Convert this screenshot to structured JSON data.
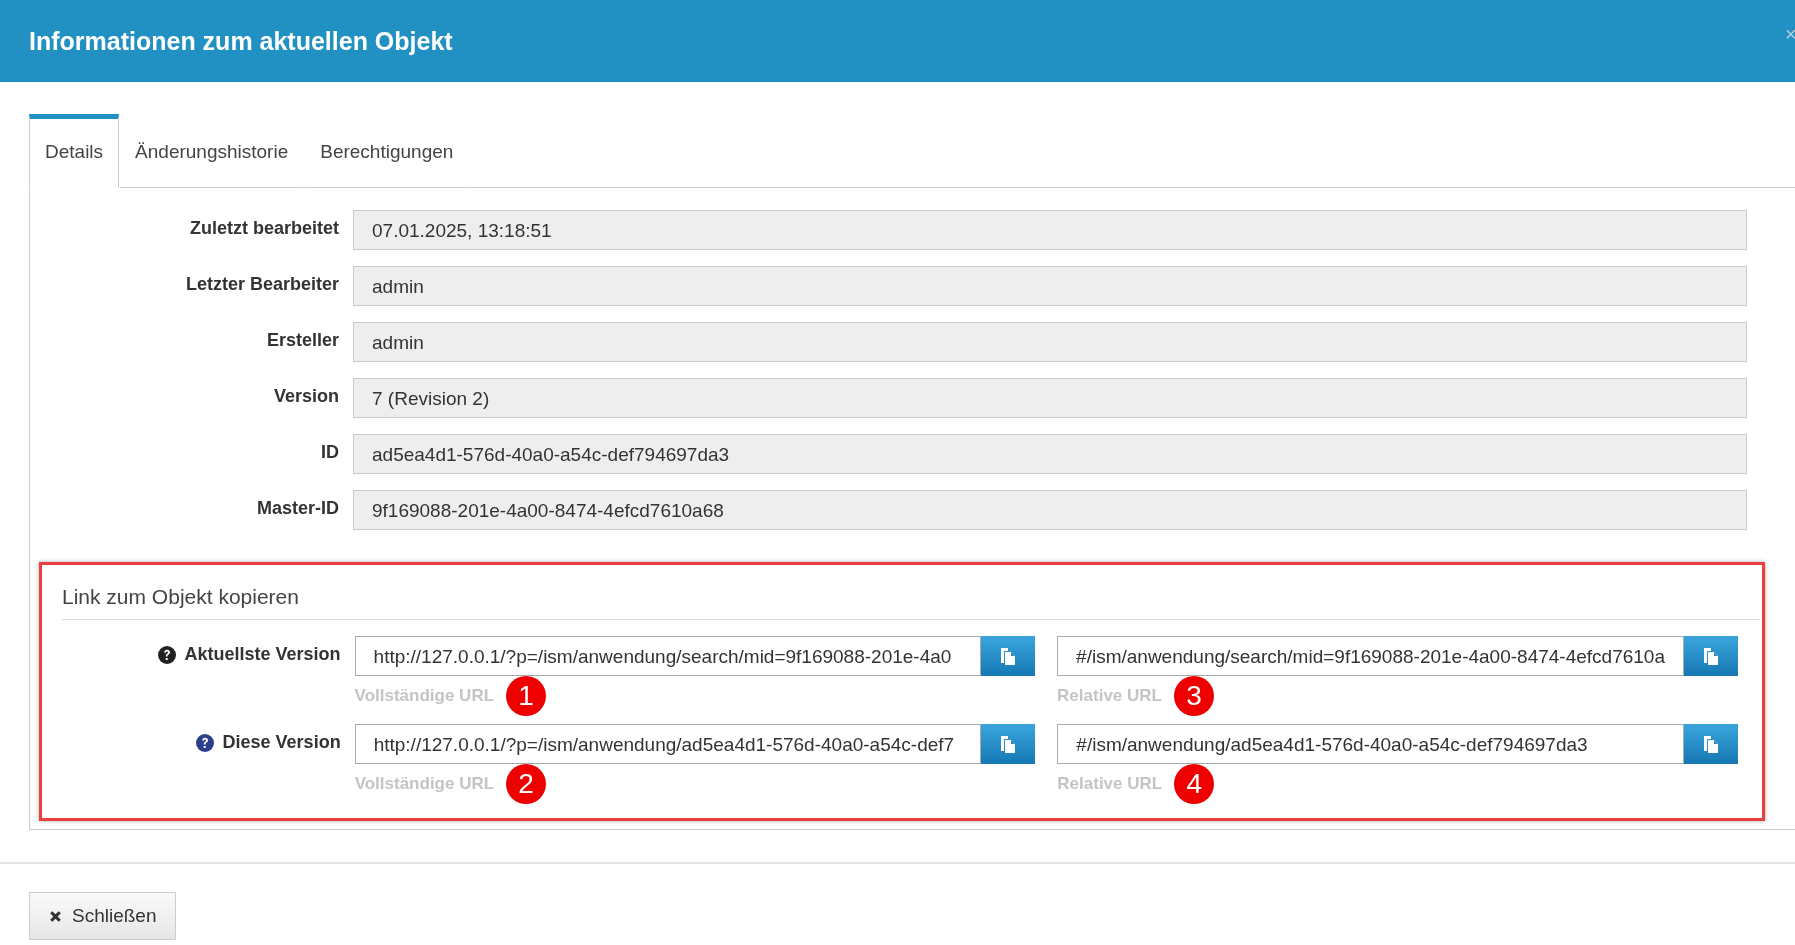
{
  "window": {
    "title": "Informationen zum aktuellen Objekt",
    "close": "×"
  },
  "tabs": [
    {
      "label": "Details",
      "selected": true
    },
    {
      "label": "Änderungshistorie",
      "selected": false
    },
    {
      "label": "Berechtigungen",
      "selected": false
    }
  ],
  "fields": [
    {
      "label": "Zuletzt bearbeitet",
      "value": "07.01.2025, 13:18:51"
    },
    {
      "label": "Letzter Bearbeiter",
      "value": "admin"
    },
    {
      "label": "Ersteller",
      "value": "admin"
    },
    {
      "label": "Version",
      "value": "7 (Revision 2)"
    },
    {
      "label": "ID",
      "value": "ad5ea4d1-576d-40a0-a54c-def794697da3"
    },
    {
      "label": "Master-ID",
      "value": "9f169088-201e-4a00-8474-4efcd7610a68"
    }
  ],
  "link_section": {
    "title": "Link zum Objekt kopieren",
    "highlighted": true,
    "rows": [
      {
        "label": "Aktuellste Version",
        "color": "#222222",
        "links": [
          {
            "value": "http://127.0.0.1/?p=/ism/anwendung/search/mid=9f169088-201e-4a0",
            "caption": "Vollständige URL",
            "marker": "1"
          },
          {
            "value": "#/ism/anwendung/search/mid=9f169088-201e-4a00-8474-4efcd7610a",
            "caption": "Relative URL",
            "marker": "3"
          }
        ]
      },
      {
        "label": "Diese Version",
        "color": "#2c3f8c",
        "links": [
          {
            "value": "http://127.0.0.1/?p=/ism/anwendung/ad5ea4d1-576d-40a0-a54c-def7",
            "caption": "Vollständige URL",
            "marker": "2"
          },
          {
            "value": "#/ism/anwendung/ad5ea4d1-576d-40a0-a54c-def794697da3",
            "caption": "Relative URL",
            "marker": "4"
          }
        ]
      }
    ]
  },
  "footer": {
    "close_button": "Schließen"
  }
}
